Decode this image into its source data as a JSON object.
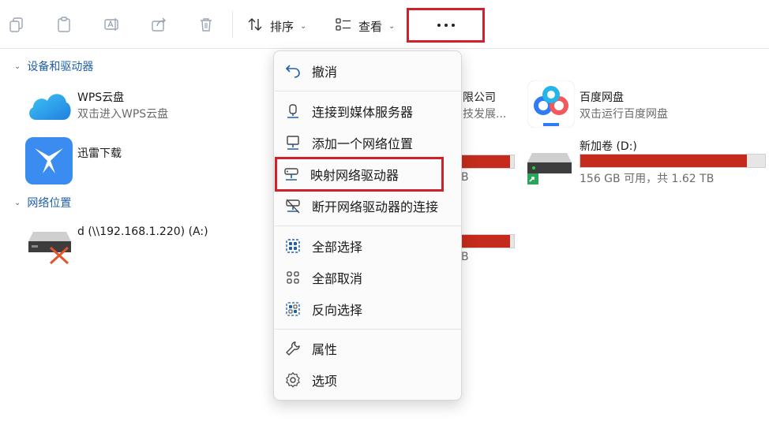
{
  "toolbar": {
    "sort_label": "排序",
    "view_label": "查看",
    "more_label": "•••"
  },
  "sections": {
    "devices": "设备和驱动器",
    "network": "网络位置"
  },
  "items": {
    "wps": {
      "title": "WPS云盘",
      "subtitle": "双击进入WPS云盘"
    },
    "xunlei": {
      "title": "迅雷下载"
    },
    "company": {
      "title": "限公司",
      "subtitle": "技发展..."
    },
    "baidu": {
      "title": "百度网盘",
      "subtitle": "双击运行百度网盘"
    },
    "drive_d": {
      "title": "新加卷 (D:)",
      "subtitle": "156 GB 可用，共 1.62 TB",
      "used_fraction": 0.9
    },
    "partial_drive_1": {
      "suffix": "B",
      "used_fraction": 0.93
    },
    "partial_drive_2": {
      "suffix": "B",
      "used_fraction": 0.93
    },
    "network_drive": {
      "title": "d (\\\\192.168.1.220) (A:)"
    }
  },
  "menu": {
    "undo": "撤消",
    "connect_media": "连接到媒体服务器",
    "add_network_location": "添加一个网络位置",
    "map_network_drive": "映射网络驱动器",
    "disconnect_network_drive": "断开网络驱动器的连接",
    "select_all": "全部选择",
    "select_none": "全部取消",
    "invert_selection": "反向选择",
    "properties": "属性",
    "options": "选项"
  },
  "colors": {
    "accent": "#1f5fa8",
    "highlight_box": "#d0202a",
    "drive_bar_full": "#c42b1c"
  }
}
